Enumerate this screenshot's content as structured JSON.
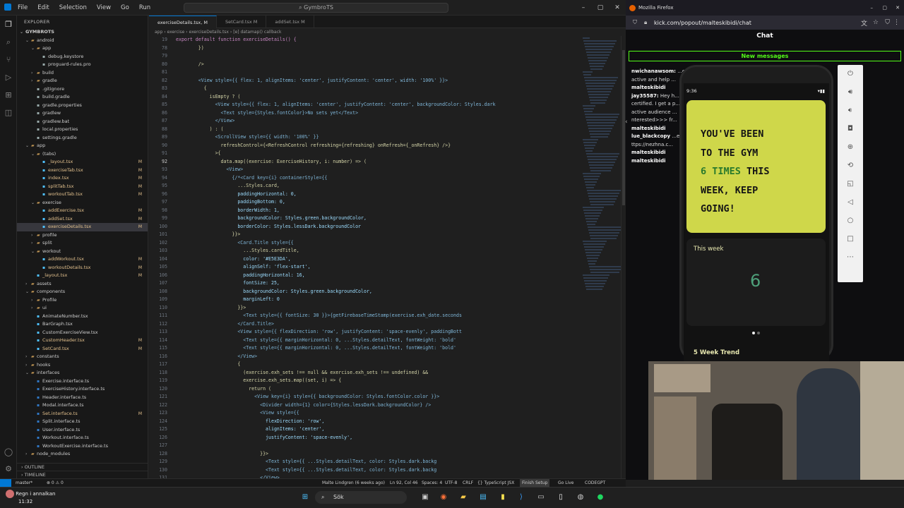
{
  "vscode": {
    "menu": [
      "File",
      "Edit",
      "Selection",
      "View",
      "Go",
      "Run"
    ],
    "search": "GymbroTS",
    "explorer_title": "EXPLORER",
    "project": "GYMBROTS",
    "tree": [
      {
        "label": "android",
        "depth": 1,
        "type": "folder-open",
        "status": ""
      },
      {
        "label": "app",
        "depth": 2,
        "type": "folder-open",
        "status": ""
      },
      {
        "label": "debug.keystore",
        "depth": 3,
        "type": "file",
        "status": ""
      },
      {
        "label": "proguard-rules.pro",
        "depth": 3,
        "type": "file",
        "status": ""
      },
      {
        "label": "build",
        "depth": 2,
        "type": "folder",
        "status": ""
      },
      {
        "label": "gradle",
        "depth": 2,
        "type": "folder",
        "status": ""
      },
      {
        "label": ".gitignore",
        "depth": 2,
        "type": "file",
        "status": ""
      },
      {
        "label": "build.gradle",
        "depth": 2,
        "type": "file",
        "status": ""
      },
      {
        "label": "gradle.properties",
        "depth": 2,
        "type": "file",
        "status": ""
      },
      {
        "label": "gradlew",
        "depth": 2,
        "type": "file",
        "status": ""
      },
      {
        "label": "gradlew.bat",
        "depth": 2,
        "type": "file",
        "status": ""
      },
      {
        "label": "local.properties",
        "depth": 2,
        "type": "file",
        "status": ""
      },
      {
        "label": "settings.gradle",
        "depth": 2,
        "type": "file",
        "status": ""
      },
      {
        "label": "app",
        "depth": 1,
        "type": "folder-open",
        "status": ""
      },
      {
        "label": "(tabs)",
        "depth": 2,
        "type": "folder-open",
        "status": ""
      },
      {
        "label": "_layout.tsx",
        "depth": 3,
        "type": "file",
        "status": "M"
      },
      {
        "label": "exerciseTab.tsx",
        "depth": 3,
        "type": "file",
        "status": "M"
      },
      {
        "label": "index.tsx",
        "depth": 3,
        "type": "file",
        "status": "M"
      },
      {
        "label": "splitTab.tsx",
        "depth": 3,
        "type": "file",
        "status": "M"
      },
      {
        "label": "workoutTab.tsx",
        "depth": 3,
        "type": "file",
        "status": "M"
      },
      {
        "label": "exercise",
        "depth": 2,
        "type": "folder-open",
        "status": ""
      },
      {
        "label": "addExercise.tsx",
        "depth": 3,
        "type": "file",
        "status": "M"
      },
      {
        "label": "addSet.tsx",
        "depth": 3,
        "type": "file",
        "status": "M"
      },
      {
        "label": "exerciseDetails.tsx",
        "depth": 3,
        "type": "file",
        "status": "M",
        "selected": true
      },
      {
        "label": "profile",
        "depth": 2,
        "type": "folder",
        "status": ""
      },
      {
        "label": "split",
        "depth": 2,
        "type": "folder",
        "status": ""
      },
      {
        "label": "workout",
        "depth": 2,
        "type": "folder-open",
        "status": ""
      },
      {
        "label": "addWorkout.tsx",
        "depth": 3,
        "type": "file",
        "status": "M"
      },
      {
        "label": "workoutDetails.tsx",
        "depth": 3,
        "type": "file",
        "status": "M"
      },
      {
        "label": "_layout.tsx",
        "depth": 2,
        "type": "file",
        "status": "M"
      },
      {
        "label": "assets",
        "depth": 1,
        "type": "folder",
        "status": ""
      },
      {
        "label": "components",
        "depth": 1,
        "type": "folder-open",
        "status": ""
      },
      {
        "label": "Profile",
        "depth": 2,
        "type": "folder",
        "status": ""
      },
      {
        "label": "ui",
        "depth": 2,
        "type": "folder",
        "status": ""
      },
      {
        "label": "AnimateNumber.tsx",
        "depth": 2,
        "type": "file",
        "status": ""
      },
      {
        "label": "BarGraph.tsx",
        "depth": 2,
        "type": "file",
        "status": ""
      },
      {
        "label": "CustomExerciseView.tsx",
        "depth": 2,
        "type": "file",
        "status": ""
      },
      {
        "label": "CustomHeader.tsx",
        "depth": 2,
        "type": "file",
        "status": "M"
      },
      {
        "label": "SetCard.tsx",
        "depth": 2,
        "type": "file",
        "status": "M"
      },
      {
        "label": "constants",
        "depth": 1,
        "type": "folder",
        "status": ""
      },
      {
        "label": "hooks",
        "depth": 1,
        "type": "folder",
        "status": ""
      },
      {
        "label": "interfaces",
        "depth": 1,
        "type": "folder-open",
        "status": ""
      },
      {
        "label": "Exercise.interface.ts",
        "depth": 2,
        "type": "file",
        "status": ""
      },
      {
        "label": "ExerciseHistory.interface.ts",
        "depth": 2,
        "type": "file",
        "status": ""
      },
      {
        "label": "Header.interface.ts",
        "depth": 2,
        "type": "file",
        "status": ""
      },
      {
        "label": "Modal.interface.ts",
        "depth": 2,
        "type": "file",
        "status": ""
      },
      {
        "label": "Set.interface.ts",
        "depth": 2,
        "type": "file",
        "status": "M"
      },
      {
        "label": "Split.interface.ts",
        "depth": 2,
        "type": "file",
        "status": ""
      },
      {
        "label": "User.interface.ts",
        "depth": 2,
        "type": "file",
        "status": ""
      },
      {
        "label": "Workout.interface.ts",
        "depth": 2,
        "type": "file",
        "status": ""
      },
      {
        "label": "WorkoutExercise.interface.ts",
        "depth": 2,
        "type": "file",
        "status": ""
      },
      {
        "label": "node_modules",
        "depth": 1,
        "type": "folder",
        "status": ""
      }
    ],
    "outline": "OUTLINE",
    "timeline": "TIMELINE",
    "tabs": [
      {
        "label": "exerciseDetails.tsx, M",
        "active": true
      },
      {
        "label": "SetCard.tsx M",
        "active": false
      },
      {
        "label": "addSet.tsx M",
        "active": false
      }
    ],
    "breadcrumb": "app › exercise › exerciseDetails.tsx › [e] datamap() callback",
    "code": [
      {
        "n": "19",
        "t": "export default function exerciseDetails() {"
      },
      {
        "n": "78",
        "t": "        })"
      },
      {
        "n": "79",
        "t": ""
      },
      {
        "n": "80",
        "t": "        />"
      },
      {
        "n": "81",
        "t": ""
      },
      {
        "n": "82",
        "t": "        <View style={{ flex: 1, alignItems: 'center', justifyContent: 'center', width: '100%' }}>"
      },
      {
        "n": "83",
        "t": "          {"
      },
      {
        "n": "84",
        "t": "            isEmpty ? ("
      },
      {
        "n": "85",
        "t": "              <View style={{ flex: 1, alignItems: 'center', justifyContent: 'center', backgroundColor: Styles.dark"
      },
      {
        "n": "86",
        "t": "                <Text style={Styles.fontColor}>No sets yet</Text>"
      },
      {
        "n": "87",
        "t": "              </View>"
      },
      {
        "n": "88",
        "t": "            ) : ("
      },
      {
        "n": "89",
        "t": "              <ScrollView style={{ width: '100%' }}"
      },
      {
        "n": "90",
        "t": "                refreshControl={<RefreshControl refreshing={refreshing} onRefresh={_onRefresh} />}"
      },
      {
        "n": "91",
        "t": "              >{"
      },
      {
        "n": "92",
        "t": "                data.map((exercise: ExerciseHistory, i: number) => ("
      },
      {
        "n": "93",
        "t": "                  <View>"
      },
      {
        "n": "94",
        "t": "                    {/*<Card key={i} containerStyle={{"
      },
      {
        "n": "95",
        "t": "                      ...Styles.card,"
      },
      {
        "n": "96",
        "t": "                      paddingHorizontal: 0,"
      },
      {
        "n": "97",
        "t": "                      paddingBottom: 0,"
      },
      {
        "n": "98",
        "t": "                      borderWidth: 1,"
      },
      {
        "n": "99",
        "t": "                      backgroundColor: Styles.green.backgroundColor,"
      },
      {
        "n": "100",
        "t": "                      borderColor: Styles.lessDark.backgroundColor"
      },
      {
        "n": "101",
        "t": "                    }}>"
      },
      {
        "n": "102",
        "t": "                      <Card.Title style={{"
      },
      {
        "n": "103",
        "t": "                        ...Styles.cardTitle,"
      },
      {
        "n": "104",
        "t": "                        color: '#E5E3DA',"
      },
      {
        "n": "105",
        "t": "                        alignSelf: 'flex-start',"
      },
      {
        "n": "106",
        "t": "                        paddingHorizontal: 16,"
      },
      {
        "n": "107",
        "t": "                        fontSize: 25,"
      },
      {
        "n": "108",
        "t": "                        backgroundColor: Styles.green.backgroundColor,"
      },
      {
        "n": "109",
        "t": "                        marginLeft: 0"
      },
      {
        "n": "110",
        "t": "                      }}>"
      },
      {
        "n": "111",
        "t": "                        <Text style={{ fontSize: 30 }}>{getFirebaseTimeStamp(exercise.exh_date.seconds"
      },
      {
        "n": "112",
        "t": "                      </Card.Title>"
      },
      {
        "n": "113",
        "t": "                      <View style={{ flexDirection: 'row', justifyContent: 'space-evenly', paddingBott"
      },
      {
        "n": "114",
        "t": "                        <Text style={{ marginHorizontal: 0, ...Styles.detailText, fontWeight: 'bold'"
      },
      {
        "n": "115",
        "t": "                        <Text style={{ marginHorizontal: 0, ...Styles.detailText, fontWeight: 'bold'"
      },
      {
        "n": "116",
        "t": "                      </View>"
      },
      {
        "n": "117",
        "t": "                      {"
      },
      {
        "n": "118",
        "t": "                        (exercise.exh_sets !== null && exercise.exh_sets !== undefined) &&"
      },
      {
        "n": "119",
        "t": "                        exercise.exh_sets.map((set, i) => {"
      },
      {
        "n": "120",
        "t": "                          return ("
      },
      {
        "n": "121",
        "t": "                            <View key={i} style={{ backgroundColor: Styles.fontColor.color }}>"
      },
      {
        "n": "122",
        "t": "                              <Divider width={1} color={Styles.lessDark.backgroundColor} />"
      },
      {
        "n": "123",
        "t": "                              <View style={{"
      },
      {
        "n": "124",
        "t": "                                flexDirection: 'row',"
      },
      {
        "n": "125",
        "t": "                                alignItems: 'center',"
      },
      {
        "n": "126",
        "t": "                                justifyContent: 'space-evenly',"
      },
      {
        "n": "127",
        "t": ""
      },
      {
        "n": "128",
        "t": "                              }}>"
      },
      {
        "n": "129",
        "t": "                                <Text style={{ ...Styles.detailText, color: Styles.dark.backg"
      },
      {
        "n": "130",
        "t": "                                <Text style={{ ...Styles.detailText, color: Styles.dark.backg"
      },
      {
        "n": "131",
        "t": "                              </View>"
      }
    ],
    "status": {
      "branch": "master*",
      "errors": "⊗ 0 ⚠ 0",
      "blame": "Malte Lindgren (6 weeks ago)",
      "position": "Ln 92, Col 46",
      "spaces": "Spaces: 4",
      "encoding": "UTF-8",
      "eol": "CRLF",
      "language": "{} TypeScript JSX",
      "finish": "Finish Setup",
      "golive": "Go Live",
      "codegpt": "CODEGPT"
    }
  },
  "firefox": {
    "window_title": "Mozilla Firefox",
    "url": "kick.com/popout/malteskibidi/chat",
    "chat_title": "Chat",
    "new_messages": "New messages",
    "chat_lines": [
      {
        "user": "nwichanawsom:",
        "text": "...ep your chat"
      },
      {
        "user": "",
        "text": "active and help ..."
      },
      {
        "user": "malteskibidi",
        "text": ""
      },
      {
        "user": "jay35587:",
        "text": "Hey h...ffiliated and"
      },
      {
        "user": "",
        "text": "certified. I get a p...gain 1000"
      },
      {
        "user": "",
        "text": "active audience ..."
      },
      {
        "user": "",
        "text": "nterested>>> fr..."
      },
      {
        "user": "malteskibidi",
        "text": ""
      },
      {
        "user": "lue_blackcopy",
        "text": "...e popular"
      },
      {
        "user": "",
        "text": "ttps://nezhna.c..."
      },
      {
        "user": "malteskibidi",
        "text": ""
      },
      {
        "user": "malteskibidi",
        "text": ""
      }
    ]
  },
  "phone": {
    "time": "9:36",
    "banner_lines": [
      "YOU'VE BEEN",
      "TO THE GYM"
    ],
    "banner_highlight": "6 TIMES",
    "banner_after_highlight": " THIS",
    "banner_lines_end": [
      "WEEK, KEEP",
      "GOING!"
    ],
    "week_label": "This week",
    "week_count": "6",
    "trend_label": "5 Week Trend"
  },
  "taskbar": {
    "weather": "Regn i annalkan",
    "time": "11:32",
    "search": "Sök"
  },
  "colors": {
    "accent": "#0078d4",
    "kick_green": "#53fc18",
    "gym_yellow": "#cfd74a",
    "count_green": "#4ea07a"
  }
}
